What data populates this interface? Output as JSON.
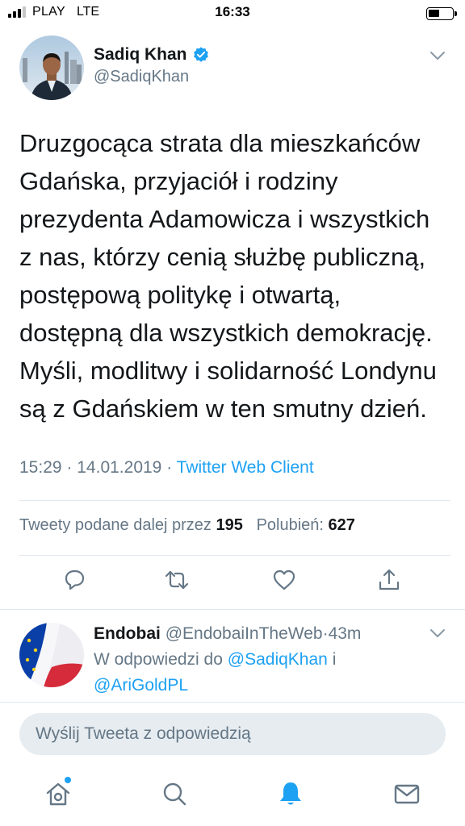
{
  "status_bar": {
    "carrier": "PLAY",
    "network": "LTE",
    "time": "16:33"
  },
  "tweet": {
    "author_name": "Sadiq Khan",
    "author_handle": "@SadiqKhan",
    "text_lines": [
      "Druzgocąca strata dla mieszkańców",
      "Gdańska, przyjaciół i rodziny",
      "prezydenta Adamowicza i wszystkich",
      "z nas, którzy cenią służbę publiczną,",
      "postępową politykę i otwartą,",
      "dostępną dla wszystkich demokrację.",
      "Myśli, modlitwy i solidarność Londynu",
      "są z Gdańskiem w ten smutny dzień."
    ],
    "time": "15:29",
    "date": "14.01.2019",
    "separator": "·",
    "client": "Twitter Web Client",
    "retweets_label": "Tweety podane dalej przez",
    "retweets_count": "195",
    "likes_label": "Polubień:",
    "likes_count": "627"
  },
  "reply": {
    "author_name": "Endobai",
    "author_handle": "@EndobaiInTheWeb",
    "separator": "·",
    "time_ago": "43m",
    "context_prefix": "W odpowiedzi do",
    "mention_1": "@SadiqKhan",
    "conjunction": "i",
    "mention_2": "@AriGoldPL"
  },
  "compose": {
    "placeholder": "Wyślij Tweeta z odpowiedzią"
  },
  "icons": {
    "verified": "verified-badge-icon",
    "reply": "reply-icon",
    "retweet": "retweet-icon",
    "like": "heart-icon",
    "share": "share-icon",
    "home": "home-icon",
    "search": "search-icon",
    "notifications": "bell-icon",
    "messages": "envelope-icon"
  },
  "colors": {
    "accent": "#1da1f2",
    "secondary_text": "#657786",
    "primary_text": "#14171a",
    "divider": "#e1e8ed",
    "compose_bg": "#e6ecf0"
  }
}
